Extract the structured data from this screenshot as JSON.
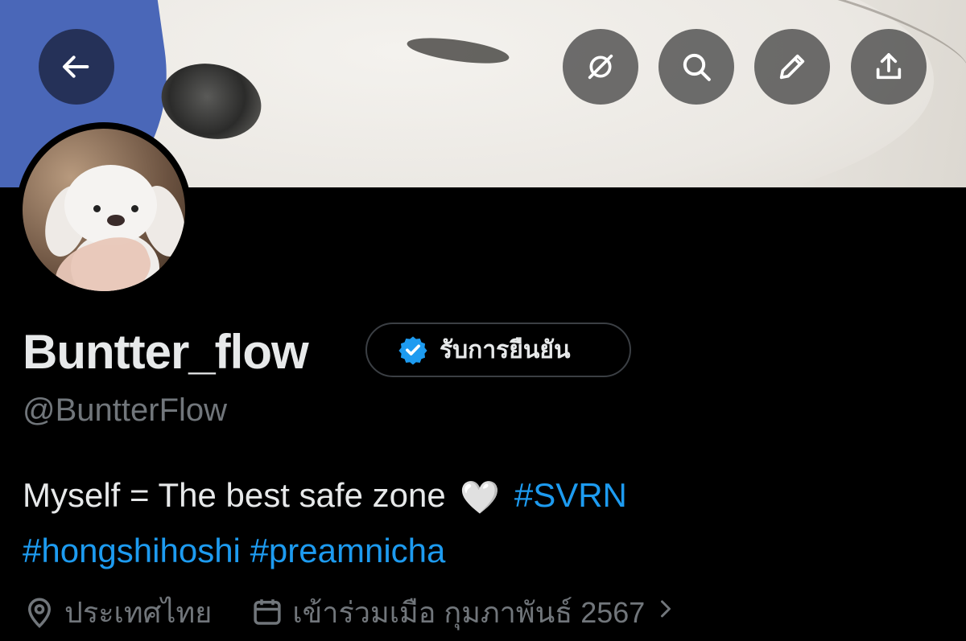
{
  "header": {
    "back_icon": "arrow-left-icon",
    "actions": [
      "grok-icon",
      "search-icon",
      "pencil-icon",
      "share-icon"
    ]
  },
  "profile": {
    "display_name": "Buntter_flow",
    "verify_label": "รับการยืนยัน",
    "handle": "@BuntterFlow",
    "bio": {
      "text": "Myself = The best safe zone",
      "emoji": "🤍",
      "hashtags": [
        "#SVRN",
        "#hongshihoshi",
        "#preamnicha"
      ]
    },
    "location": "ประเทศไทย",
    "joined": "เข้าร่วมเมือ กุมภาพันธ์ 2567"
  },
  "colors": {
    "background": "#000000",
    "text": "#e7e9ea",
    "muted": "#71767b",
    "link": "#1d9bf0",
    "verified": "#1d9bf0"
  }
}
